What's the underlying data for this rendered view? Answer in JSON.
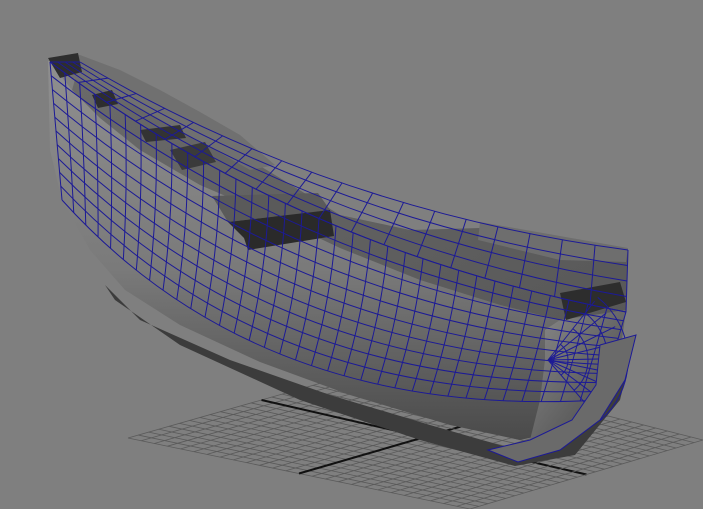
{
  "viewport": {
    "background_color": "#7f7f7f",
    "grid_line_color": "#5a5a5a",
    "grid_axis_color": "#111111",
    "wireframe_color": "#1c1a96",
    "mesh_light_color": "#8e8e8e",
    "mesh_mid_color": "#6e6e6e",
    "mesh_dark_color": "#2f2f2f",
    "selection_mode": "wireframe-on-shaded"
  },
  "scene_objects": [
    {
      "kind": "ship-hull",
      "selected": true
    }
  ]
}
